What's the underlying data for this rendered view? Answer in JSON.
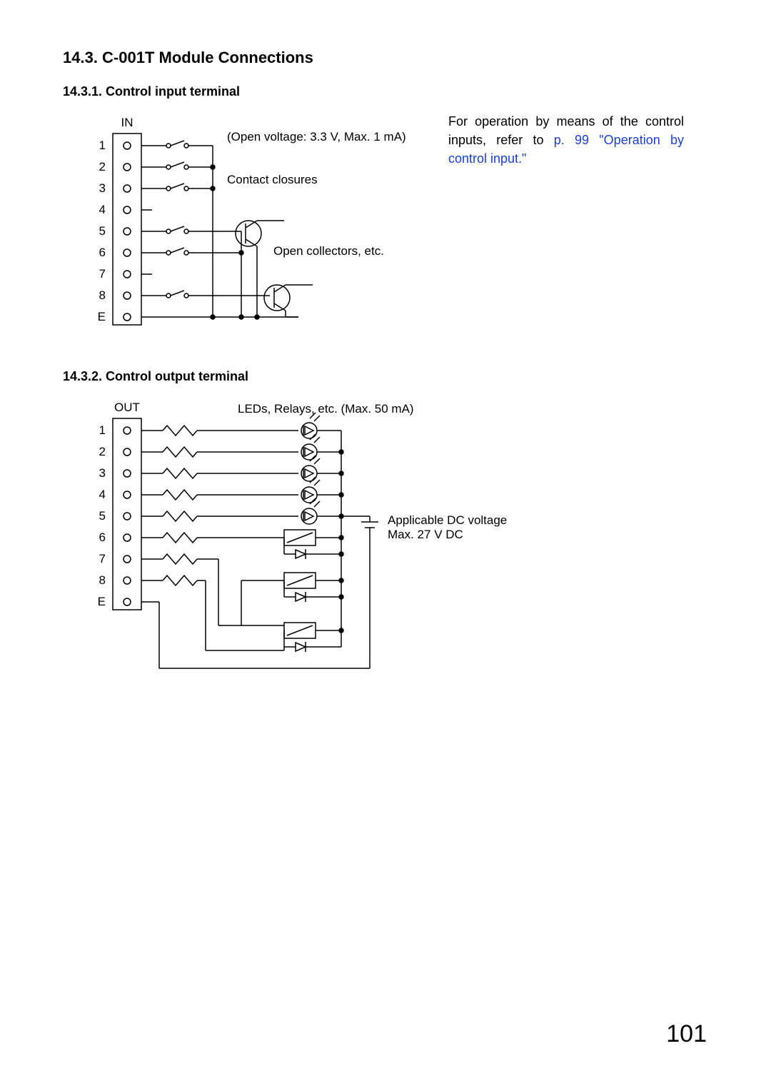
{
  "section_title": "14.3. C-001T Module Connections",
  "sub1_title": "14.3.1. Control input terminal",
  "sub2_title": "14.3.2. Control output terminal",
  "side_note_pre": "For operation by means of the control inputs, refer to ",
  "side_note_link": "p. 99 \"Operation by control input.\"",
  "in": {
    "header": "IN",
    "pins": [
      "1",
      "2",
      "3",
      "4",
      "5",
      "6",
      "7",
      "8",
      "E"
    ],
    "open_voltage": "(Open voltage: 3.3 V, Max. 1 mA)",
    "contact_closures": "Contact closures",
    "open_collectors": "Open collectors, etc."
  },
  "out": {
    "header": "OUT",
    "pins": [
      "1",
      "2",
      "3",
      "4",
      "5",
      "6",
      "7",
      "8",
      "E"
    ],
    "leds_relays": "LEDs, Relays, etc. (Max. 50 mA)",
    "dc_voltage": "Applicable DC voltage\nMax. 27 V DC"
  },
  "page_number": "101"
}
